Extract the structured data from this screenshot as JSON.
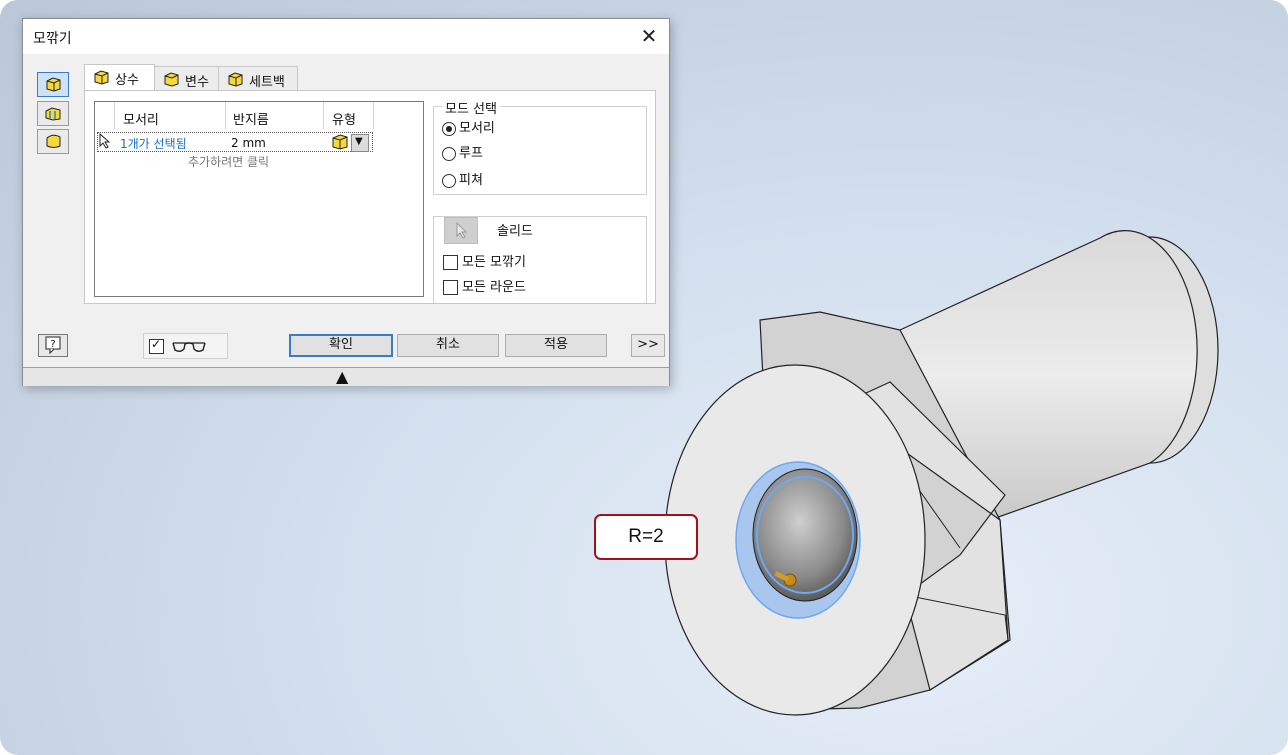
{
  "dialog": {
    "title": "모깎기",
    "tabs": [
      {
        "label": "상수"
      },
      {
        "label": "변수"
      },
      {
        "label": "세트백"
      }
    ],
    "side_buttons": [
      "edge-fillet-icon",
      "face-fillet-icon",
      "full-round-fillet-icon"
    ],
    "grid": {
      "columns": [
        "모서리",
        "반지름",
        "유형"
      ],
      "rows": [
        {
          "edges": "1개가 선택됨",
          "radius": "2 mm",
          "type_icon": "edge-fillet-icon"
        }
      ],
      "add_hint": "추가하려면 클릭"
    },
    "mode_select": {
      "legend": "모드 선택",
      "options": [
        {
          "label": "모서리",
          "checked": true
        },
        {
          "label": "루프",
          "checked": false
        },
        {
          "label": "피쳐",
          "checked": false
        }
      ]
    },
    "solid": {
      "label": "솔리드",
      "all_fillets": {
        "label": "모든 모깎기",
        "checked": false
      },
      "all_rounds": {
        "label": "모든 라운드",
        "checked": false
      }
    },
    "buttons": {
      "ok": "확인",
      "cancel": "취소",
      "apply": "적용",
      "expand": ">>"
    },
    "preview": {
      "checked": true,
      "icon": "glasses-icon"
    },
    "help_icon": "help-icon"
  },
  "callout": {
    "text": "R=2"
  },
  "colors": {
    "accent": "#3a7bc8",
    "link_text": "#1a6fc4",
    "callout_border": "#a30f1a",
    "selection_highlight": "#6fa8ee"
  }
}
